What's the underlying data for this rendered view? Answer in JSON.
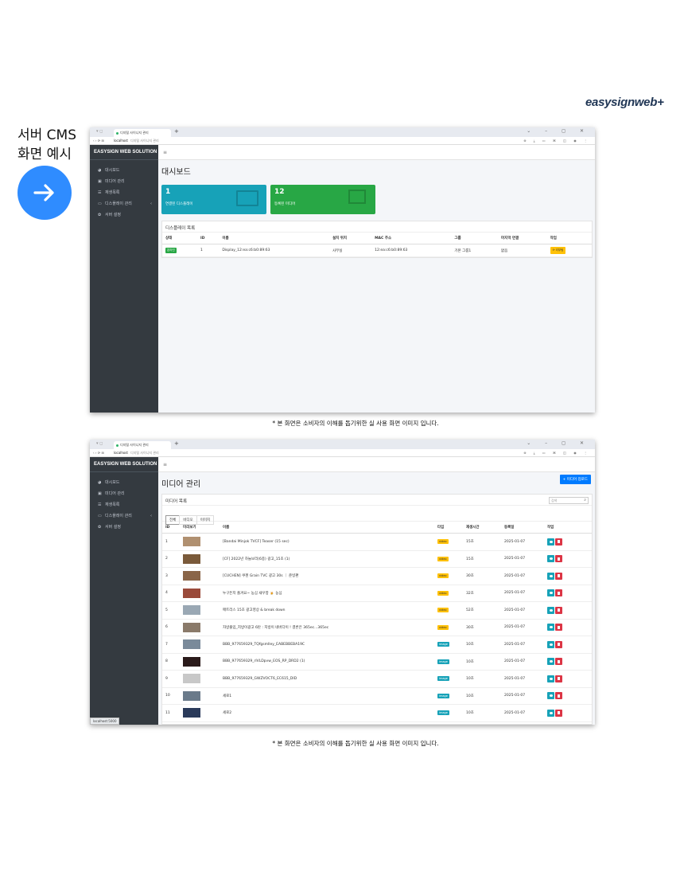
{
  "brand": {
    "logo_text": "easysignweb+"
  },
  "side": {
    "line1": "서버 CMS",
    "line2": "화면 예시"
  },
  "browser": {
    "tab_title": "디지털 사이니지 관리",
    "url_host": "localhost",
    "url_title": "디지털 사이니지 관리"
  },
  "app": {
    "brand": "EASYSIGN WEB SOLUTION",
    "menu": [
      {
        "label": "대시보드",
        "icon": "dashboard-icon"
      },
      {
        "label": "미디어 관리",
        "icon": "media-icon"
      },
      {
        "label": "재생목록",
        "icon": "list-icon"
      },
      {
        "label": "디스플레이 관리",
        "icon": "display-icon"
      },
      {
        "label": "서버 설정",
        "icon": "gear-icon"
      }
    ],
    "hamburger": "≡"
  },
  "dashboard": {
    "title": "대시보드",
    "cards": [
      {
        "num": "1",
        "label": "연결된 디스플레이"
      },
      {
        "num": "12",
        "label": "등록된 미디어"
      }
    ],
    "panel_title": "디스플레이 목록",
    "headers": [
      "상태",
      "ID",
      "이름",
      "설치 위치",
      "MAC 주소",
      "그룹",
      "마지막 연결",
      "작업"
    ],
    "rows": [
      {
        "status": "온라인",
        "id": "1",
        "name": "Display_12:ea:c6:b0:89:63",
        "location": "사무실",
        "mac": "12:ea:c6:b0:89:63",
        "group": "기본 그룹1",
        "last": "없음",
        "action": "리부팅"
      }
    ]
  },
  "media": {
    "title": "미디어 관리",
    "upload_label": "+ 미디어 업로드",
    "panel_title": "미디어 목록",
    "search_placeholder": "검색",
    "tabs": [
      "전체",
      "비디오",
      "이미지"
    ],
    "headers": [
      "ID",
      "미리보기",
      "이름",
      "타입",
      "재생시간",
      "등록일",
      "작업"
    ],
    "rows": [
      {
        "id": "1",
        "name": "[Bandai Minjok TVCF] Teaser (15 sec)",
        "type": "video",
        "dur": "15초",
        "date": "2025-01-07",
        "thumb": "#b09070"
      },
      {
        "id": "2",
        "name": "[CF] 2022년 하늘보리(6종) 광고_15초 (1)",
        "type": "video",
        "dur": "15초",
        "date": "2025-01-07",
        "thumb": "#7a5a3a"
      },
      {
        "id": "3",
        "name": "[CUCHEN] 쿠첸 Grain TVC 광고 30s ｜ 준빙편",
        "type": "video",
        "dur": "30초",
        "date": "2025-01-07",
        "thumb": "#8a6548"
      },
      {
        "id": "4",
        "name": "누구든지 즐겨요~ 농심 새우깡 🍺 농심",
        "type": "video",
        "dur": "32초",
        "date": "2025-01-07",
        "thumb": "#9a4a3a"
      },
      {
        "id": "5",
        "name": "매트리스 15초 광고영상 & break down",
        "type": "video",
        "dur": "52초",
        "date": "2025-01-07",
        "thumb": "#9aa8b4"
      },
      {
        "id": "6",
        "name": "자방출입_지방이광고 6탄 : 지방이 네버다이 ! 결론은 365ec...365ec",
        "type": "video",
        "dur": "30초",
        "date": "2025-01-07",
        "thumb": "#8a7a6a"
      },
      {
        "id": "7",
        "name": "BBB_977659329_TQfgsmlley_EABEBBEBA19C",
        "type": "image",
        "dur": "10초",
        "date": "2025-01-07",
        "thumb": "#7a8a9a"
      },
      {
        "id": "8",
        "name": "BBB_977659329_rlVLDpvw_EOS_RP_DRD2 (1)",
        "type": "image",
        "dur": "10초",
        "date": "2025-01-07",
        "thumb": "#2a1a1a"
      },
      {
        "id": "9",
        "name": "BBB_977659329_GWZVOCT6_EC615_DID",
        "type": "image",
        "dur": "10초",
        "date": "2025-01-07",
        "thumb": "#c8c8c8"
      },
      {
        "id": "10",
        "name": "세로1",
        "type": "image",
        "dur": "10초",
        "date": "2025-01-07",
        "thumb": "#6a7a8a"
      },
      {
        "id": "11",
        "name": "세로2",
        "type": "image",
        "dur": "10초",
        "date": "2025-01-07",
        "thumb": "#2a3a5a"
      }
    ],
    "status_tip": "localhost:5000"
  },
  "caption": "* 본 화면은 소비자의 이해를 돕기위한  실 사용 화면 이미지 입니다."
}
